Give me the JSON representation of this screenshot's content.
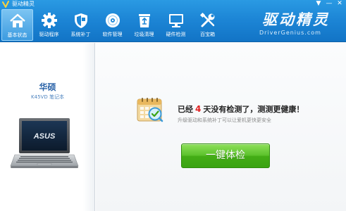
{
  "app": {
    "title": "驱动精灵",
    "window_buttons": [
      "▼",
      "—",
      "✕"
    ]
  },
  "nav": {
    "items": [
      {
        "label": "基本状态",
        "icon": "home-icon",
        "active": true
      },
      {
        "label": "驱动程序",
        "icon": "gear-icon",
        "active": false
      },
      {
        "label": "系统补丁",
        "icon": "shield-icon",
        "active": false
      },
      {
        "label": "软件管理",
        "icon": "disc-icon",
        "active": false
      },
      {
        "label": "垃圾清理",
        "icon": "recycle-bin-icon",
        "active": false
      },
      {
        "label": "硬件检测",
        "icon": "monitor-icon",
        "active": false
      },
      {
        "label": "百宝箱",
        "icon": "tools-icon",
        "active": false
      }
    ]
  },
  "brand": {
    "logo_text": "驱动精灵",
    "site": "DriverGenius.com"
  },
  "device": {
    "brand": "华硕",
    "model": "K45VD 笔记本",
    "logo_on_screen": "ASUS"
  },
  "status": {
    "prefix": "已经",
    "days": "4",
    "suffix": "天没有检测了，测测更健康！",
    "subtitle": "升级驱动和系统补丁可以让爱机更快更安全"
  },
  "actions": {
    "check_button": "一键体检"
  },
  "colors": {
    "header_blue": "#1d86d6",
    "accent_red": "#e02020",
    "button_green": "#44ad16",
    "device_blue": "#2a63a8"
  }
}
